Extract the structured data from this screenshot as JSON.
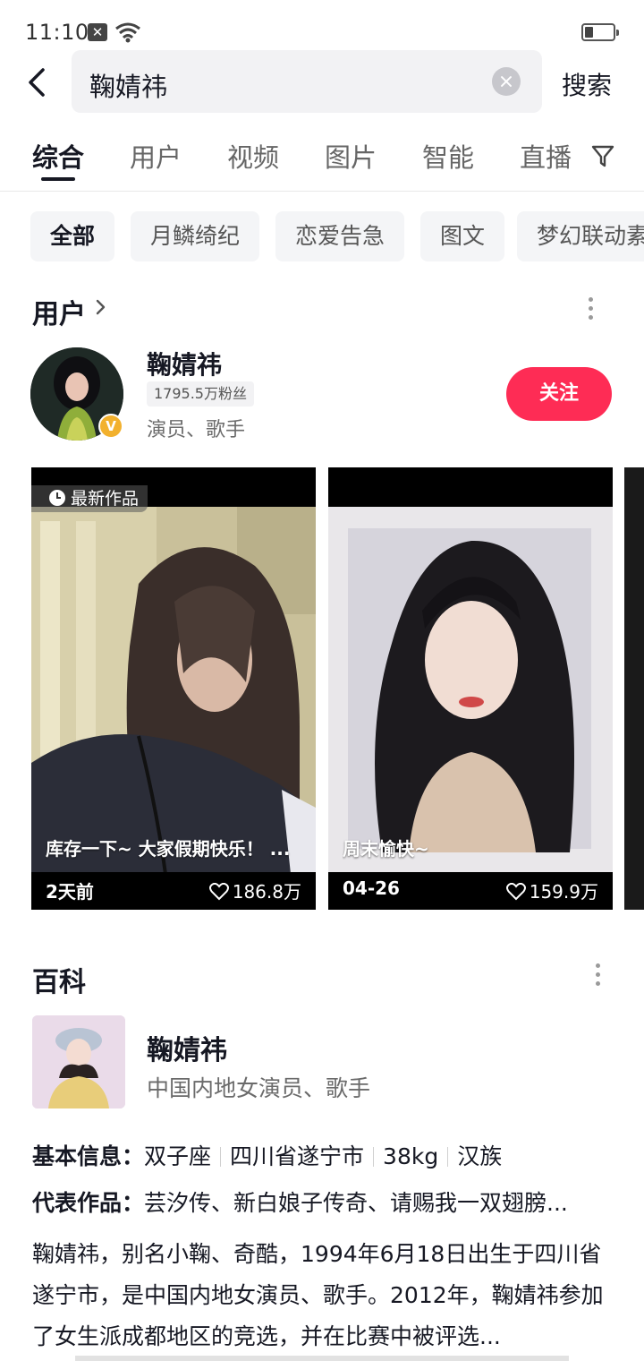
{
  "status_bar": {
    "time": "11:10"
  },
  "search": {
    "query": "鞠婧祎",
    "button_label": "搜索"
  },
  "tabs": [
    {
      "label": "综合",
      "active": true
    },
    {
      "label": "用户"
    },
    {
      "label": "视频"
    },
    {
      "label": "图片"
    },
    {
      "label": "智能"
    },
    {
      "label": "直播"
    }
  ],
  "chips": [
    {
      "label": "全部",
      "active": true
    },
    {
      "label": "月鳞绮纪"
    },
    {
      "label": "恋爱告急"
    },
    {
      "label": "图文"
    },
    {
      "label": "梦幻联动素"
    }
  ],
  "user_section": {
    "title": "用户",
    "user": {
      "name": "鞠婧祎",
      "fans": "1795.5万粉丝",
      "tags": "演员、歌手",
      "follow_label": "关注",
      "verified_mark": "V"
    },
    "videos": [
      {
        "badge": "最新作品",
        "caption": "库存一下~ 大家假期快乐！ ...",
        "date": "2天前",
        "likes": "186.8万"
      },
      {
        "caption": "周末愉快~",
        "date": "04-26",
        "likes": "159.9万"
      }
    ]
  },
  "baike": {
    "title": "百科",
    "name": "鞠婧祎",
    "description": "中国内地女演员、歌手",
    "basic_label": "基本信息：",
    "basic_values": [
      "双子座",
      "四川省遂宁市",
      "38kg",
      "汉族"
    ],
    "works_label": "代表作品：",
    "works_value": "芸汐传、新白娘子传奇、请赐我一双翅膀...",
    "intro": "鞠婧祎，别名小鞠、奇酷，1994年6月18日出生于四川省遂宁市，是中国内地女演员、歌手。2012年，鞠婧祎参加了女生派成都地区的竞选，并在比赛中被评选..."
  },
  "colors": {
    "accent": "#fe2c55",
    "verified": "#f2b12e"
  }
}
